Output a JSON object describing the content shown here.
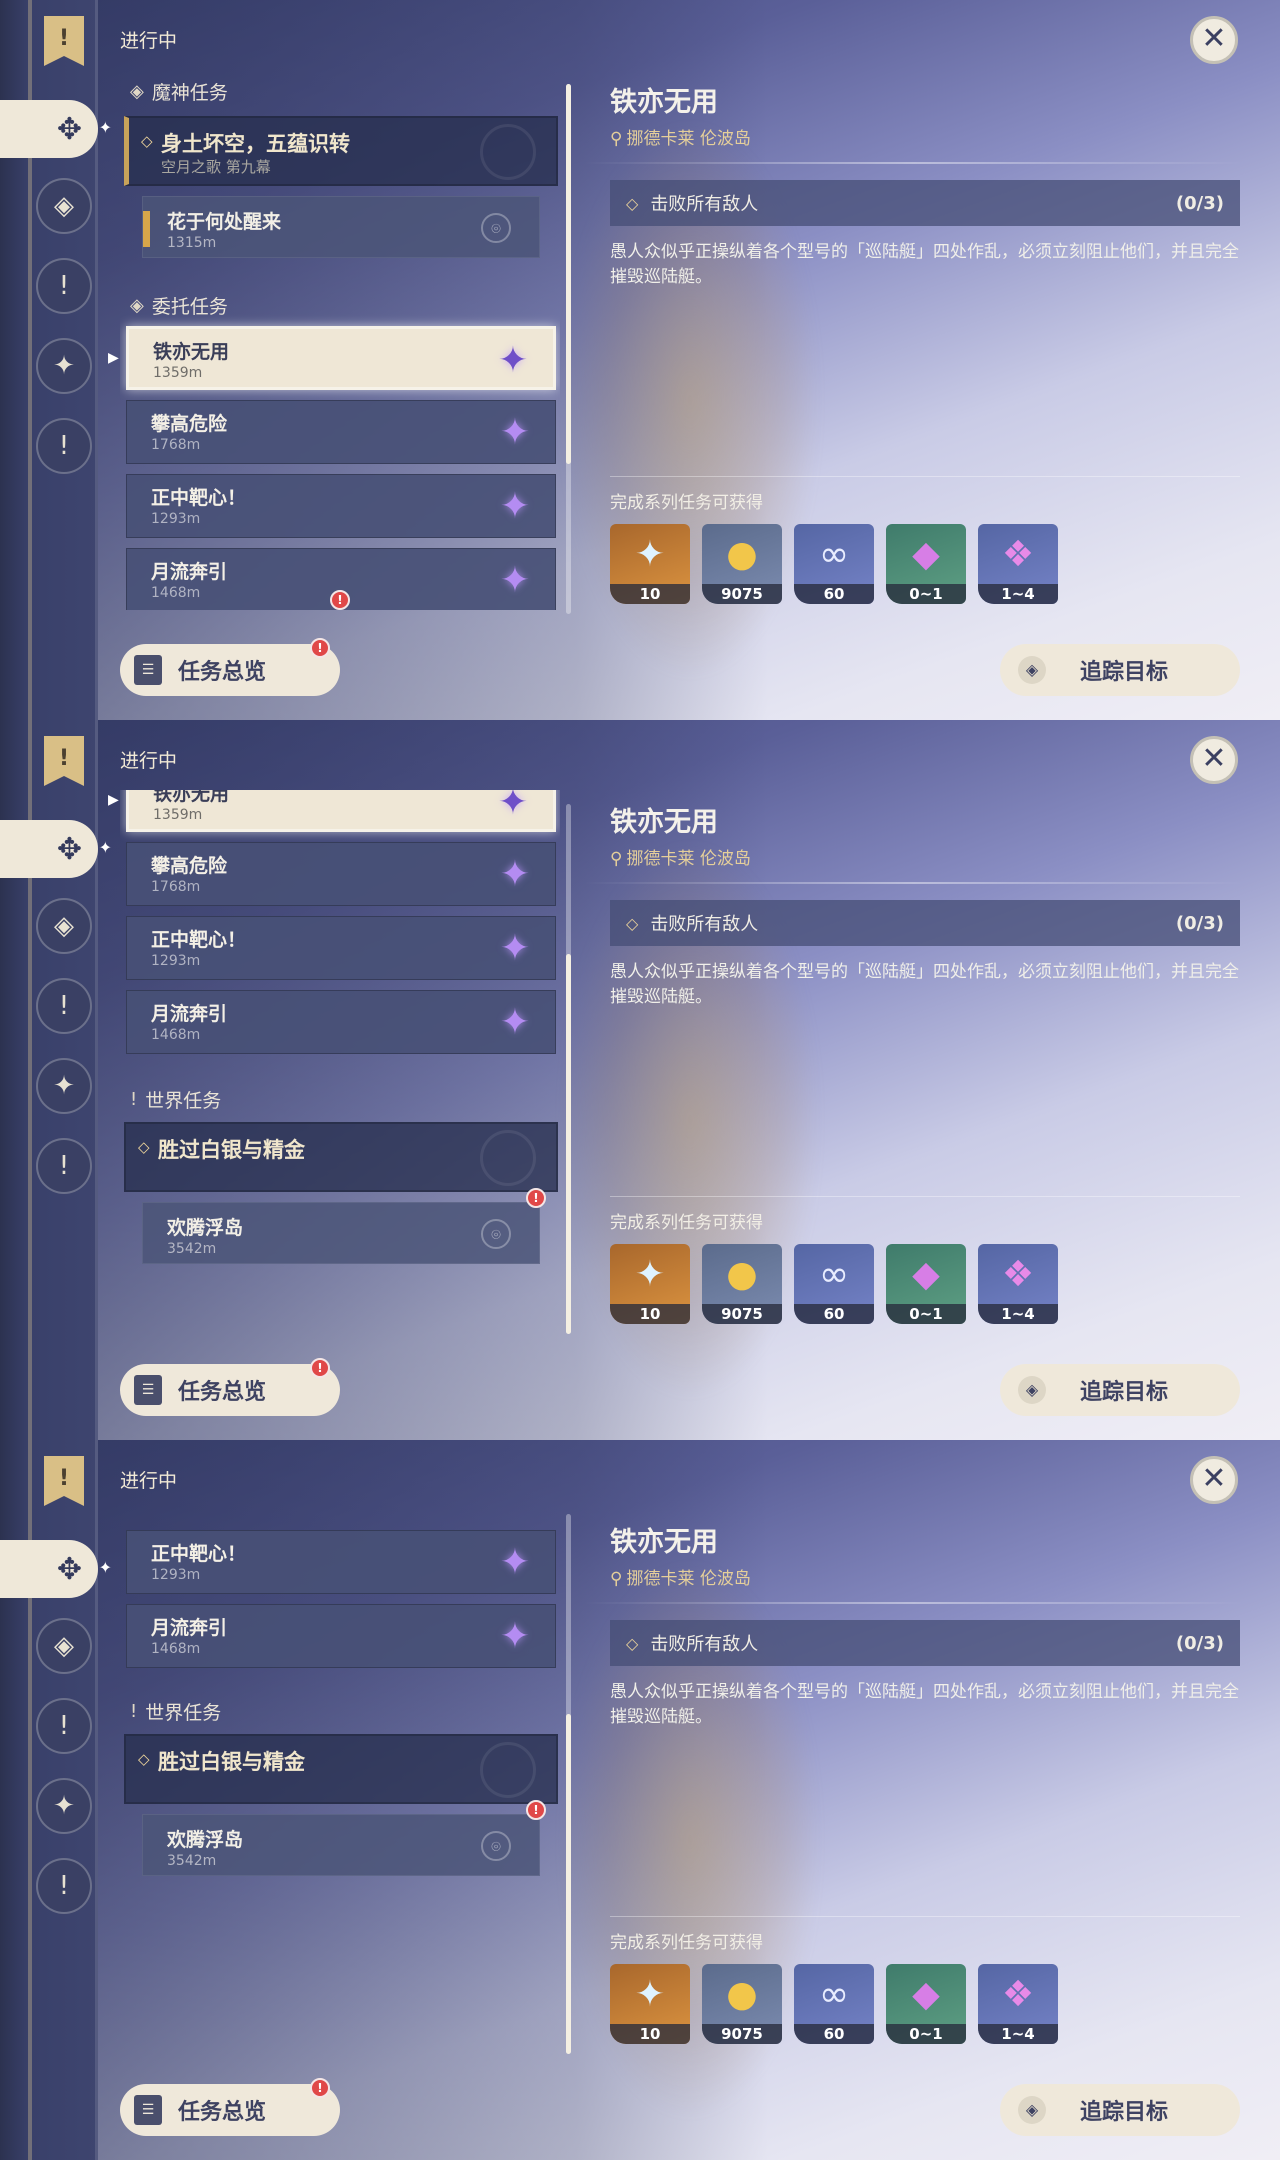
{
  "rail": {
    "top_glyph": "!",
    "active_glyph": "✥",
    "icons": [
      "◈",
      "!",
      "✦",
      "!"
    ]
  },
  "header": {
    "in_progress": "进行中",
    "close_glyph": "✕"
  },
  "sections": {
    "archon": "魔神任务",
    "commission": "委托任务",
    "world": "世界任务"
  },
  "archon_quest": {
    "title": "身土坏空，五蕴识转",
    "subtitle": "空月之歌 第九幕",
    "sub_title": "花于何处醒来",
    "sub_dist": "1315m"
  },
  "commissions": [
    {
      "title": "铁亦无用",
      "dist": "1359m"
    },
    {
      "title": "攀高危险",
      "dist": "1768m"
    },
    {
      "title": "正中靶心！",
      "dist": "1293m"
    },
    {
      "title": "月流奔引",
      "dist": "1468m"
    }
  ],
  "world_quest": {
    "title": "胜过白银与精金",
    "sub_title": "欢腾浮岛",
    "sub_dist": "3542m"
  },
  "buttons": {
    "overview": "任务总览",
    "track": "追踪目标"
  },
  "detail": {
    "title": "铁亦无用",
    "location": "挪德卡莱 伦波岛",
    "objective": "击败所有敌人",
    "objective_count": "(0/3)",
    "description": "愚人众似乎正操纵着各个型号的「巡陆艇」四处作乱，必须立刻阻止他们，并且完全摧毁巡陆艇。",
    "rewards_header": "完成系列任务可获得",
    "rewards": [
      {
        "icon": "primogem-icon",
        "qty": "10"
      },
      {
        "icon": "mora-icon",
        "qty": "9075"
      },
      {
        "icon": "exp-icon",
        "qty": "60"
      },
      {
        "icon": "crystal-icon",
        "qty": "0~1"
      },
      {
        "icon": "crystal-cluster-icon",
        "qty": "1~4"
      }
    ]
  },
  "colors": {
    "accent_gold": "#e5cf9a",
    "selected_bg": "#efe7d6",
    "star_purple": "#b48cf2",
    "badge_red": "#e04848"
  }
}
